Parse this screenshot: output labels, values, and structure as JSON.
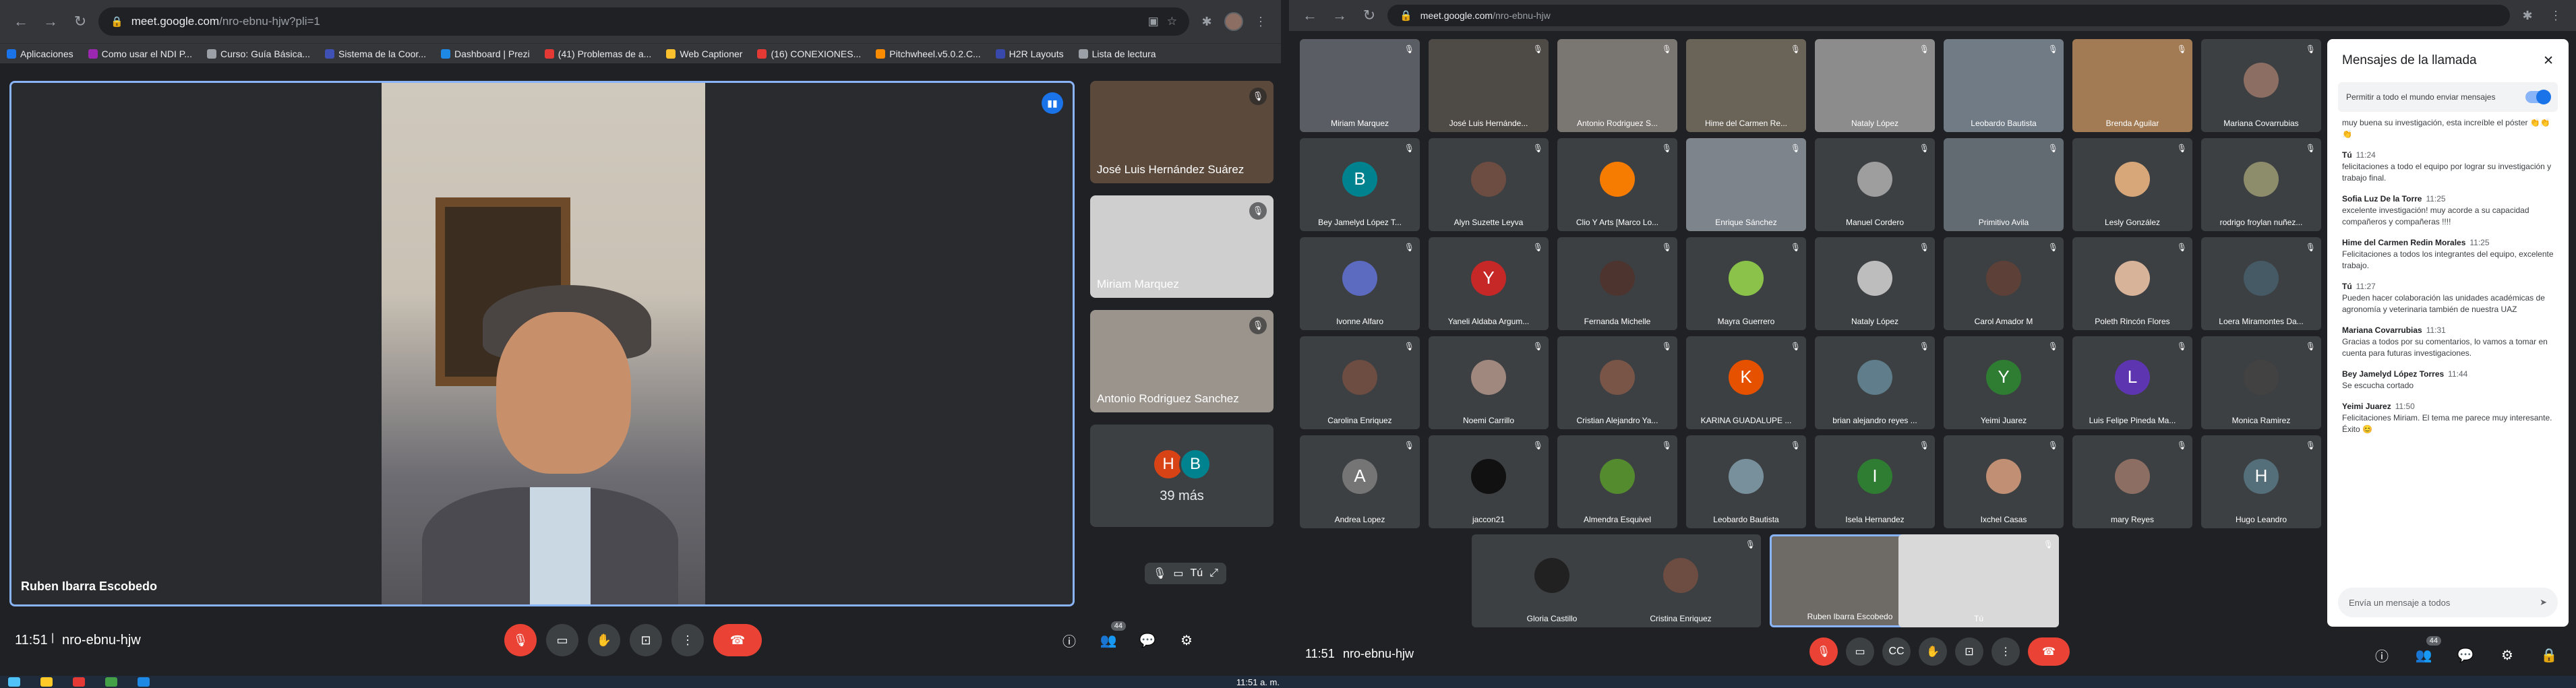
{
  "left": {
    "url_host": "meet.google.com",
    "url_path": "/nro-ebnu-hjw?pli=1",
    "bookmarks": [
      {
        "label": "Aplicaciones",
        "color": "#1a73e8"
      },
      {
        "label": "Como usar el NDI P...",
        "color": "#9c27b0"
      },
      {
        "label": "Curso: Guía Básica...",
        "color": "#9aa0a6"
      },
      {
        "label": "Sistema de la Coor...",
        "color": "#3f51b5"
      },
      {
        "label": "Dashboard | Prezi",
        "color": "#1e88e5"
      },
      {
        "label": "(41) Problemas de a...",
        "color": "#e53935"
      },
      {
        "label": "Web Captioner",
        "color": "#fbc02d"
      },
      {
        "label": "(16) CONEXIONES...",
        "color": "#e53935"
      },
      {
        "label": "Pitchwheel.v5.0.2.C...",
        "color": "#fb8c00"
      },
      {
        "label": "H2R Layouts",
        "color": "#3949ab"
      },
      {
        "label": "Lista de lectura",
        "color": "#9aa0a6"
      }
    ],
    "main_speaker": "Ruben Ibarra Escobedo",
    "side_tiles": [
      {
        "name": "José Luis Hernández Suárez"
      },
      {
        "name": "Miriam Marquez"
      },
      {
        "name": "Antonio Rodriguez Sanchez"
      }
    ],
    "more": {
      "initials": [
        "H",
        "B"
      ],
      "label": "39 más"
    },
    "self_label": "Tú",
    "clock": "11:51",
    "code": "nro-ebnu-hjw",
    "people_count": "44"
  },
  "right": {
    "url_host": "meet.google.com",
    "url_path": "/nro-ebnu-hjw",
    "tiles": [
      {
        "name": "Miriam Marquez",
        "kind": "video",
        "bg": "#5a5d63"
      },
      {
        "name": "José Luis Hernánde...",
        "kind": "video",
        "bg": "#4e4a46"
      },
      {
        "name": "Antonio Rodriguez S...",
        "kind": "video",
        "bg": "#7a7672"
      },
      {
        "name": "Hime del Carmen Re...",
        "kind": "video",
        "bg": "#6a6358"
      },
      {
        "name": "Nataly López",
        "kind": "video",
        "bg": "#8c8c8c"
      },
      {
        "name": "Leobardo Bautista",
        "kind": "video",
        "bg": "#707b86"
      },
      {
        "name": "Brenda Aguilar",
        "kind": "video",
        "bg": "#a27b55"
      },
      {
        "name": "Mariana Covarrubias",
        "kind": "pic",
        "bg": "#3c4043",
        "pc": "#8d6e63"
      },
      {
        "name": "Bey Jamelyd López T...",
        "kind": "ini",
        "bg": "#3c4043",
        "ini": "B",
        "pc": "#00838f"
      },
      {
        "name": "Alyn Suzette Leyva",
        "kind": "pic",
        "bg": "#3c4043",
        "pc": "#6d4c41"
      },
      {
        "name": "Clio Y Arts [Marco Lo...",
        "kind": "pic",
        "bg": "#3c4043",
        "pc": "#f57c00"
      },
      {
        "name": "Enrique Sánchez",
        "kind": "video",
        "bg": "#7d848c"
      },
      {
        "name": "Manuel Cordero",
        "kind": "pic",
        "bg": "#3c4043",
        "pc": "#9e9e9e"
      },
      {
        "name": "Primitivo Avila",
        "kind": "video",
        "bg": "#626a72"
      },
      {
        "name": "Lesly González",
        "kind": "pic",
        "bg": "#3c4043",
        "pc": "#d7a77a"
      },
      {
        "name": "rodrigo froylan nuñez...",
        "kind": "pic",
        "bg": "#3c4043",
        "pc": "#8d8d6b"
      },
      {
        "name": "Ivonne Alfaro",
        "kind": "pic",
        "bg": "#3c4043",
        "pc": "#5c6bc0"
      },
      {
        "name": "Yaneli Aldaba Argum...",
        "kind": "ini",
        "bg": "#3c4043",
        "ini": "Y",
        "pc": "#c62828"
      },
      {
        "name": "Fernanda Michelle",
        "kind": "pic",
        "bg": "#3c4043",
        "pc": "#4e342e"
      },
      {
        "name": "Mayra Guerrero",
        "kind": "pic",
        "bg": "#3c4043",
        "pc": "#8bc34a"
      },
      {
        "name": "Nataly López",
        "kind": "pic",
        "bg": "#3c4043",
        "pc": "#bdbdbd"
      },
      {
        "name": "Carol Amador M",
        "kind": "pic",
        "bg": "#3c4043",
        "pc": "#5d4037"
      },
      {
        "name": "Poleth Rincón Flores",
        "kind": "pic",
        "bg": "#3c4043",
        "pc": "#d7b39a"
      },
      {
        "name": "Loera Miramontes Da...",
        "kind": "pic",
        "bg": "#3c4043",
        "pc": "#455a64"
      },
      {
        "name": "Carolina Enriquez",
        "kind": "pic",
        "bg": "#3c4043",
        "pc": "#6d4c41"
      },
      {
        "name": "Noemi Carrillo",
        "kind": "pic",
        "bg": "#3c4043",
        "pc": "#a1887f"
      },
      {
        "name": "Cristian Alejandro Ya...",
        "kind": "pic",
        "bg": "#3c4043",
        "pc": "#795548"
      },
      {
        "name": "KARINA GUADALUPE ...",
        "kind": "ini",
        "bg": "#3c4043",
        "ini": "K",
        "pc": "#e65100"
      },
      {
        "name": "brian alejandro reyes ...",
        "kind": "pic",
        "bg": "#3c4043",
        "pc": "#607d8b"
      },
      {
        "name": "Yeimi Juarez",
        "kind": "ini",
        "bg": "#3c4043",
        "ini": "Y",
        "pc": "#2e7d32"
      },
      {
        "name": "Luis Felipe Pineda Ma...",
        "kind": "ini",
        "bg": "#3c4043",
        "ini": "L",
        "pc": "#5e35b1"
      },
      {
        "name": "Monica Ramirez",
        "kind": "pic",
        "bg": "#3c4043",
        "pc": "#424242"
      },
      {
        "name": "Andrea Lopez",
        "kind": "ini",
        "bg": "#3c4043",
        "ini": "A",
        "pc": "#757575"
      },
      {
        "name": "jaccon21",
        "kind": "pic",
        "bg": "#3c4043",
        "pc": "#111111"
      },
      {
        "name": "Almendra Esquivel",
        "kind": "pic",
        "bg": "#3c4043",
        "pc": "#558b2f"
      },
      {
        "name": "Leobardo Bautista",
        "kind": "pic",
        "bg": "#3c4043",
        "pc": "#78909c"
      },
      {
        "name": "Isela Hernandez",
        "kind": "ini",
        "bg": "#3c4043",
        "ini": "I",
        "pc": "#2e7d32"
      },
      {
        "name": "Ixchel Casas",
        "kind": "pic",
        "bg": "#3c4043",
        "pc": "#c08f74"
      },
      {
        "name": "mary Reyes",
        "kind": "pic",
        "bg": "#3c4043",
        "pc": "#8d6e63"
      },
      {
        "name": "Hugo Leandro",
        "kind": "ini",
        "bg": "#3c4043",
        "ini": "H",
        "pc": "#546e7a"
      },
      {
        "name": "Gloria Castillo",
        "kind": "pic",
        "bg": "#3c4043",
        "pc": "#212121"
      },
      {
        "name": "Cristina Enriquez",
        "kind": "pic",
        "bg": "#3c4043",
        "pc": "#6d4c41"
      },
      {
        "name": "Ruben Ibarra Escobedo",
        "kind": "video",
        "bg": "#6e6a66",
        "active": true
      },
      {
        "name": "Tú",
        "kind": "video",
        "bg": "#d9d9d9"
      }
    ],
    "chat": {
      "title": "Mensajes de la llamada",
      "toggle_label": "Permitir a todo el mundo enviar mensajes",
      "messages": [
        {
          "who": "",
          "time": "",
          "text": "muy buena su investigación, esta increíble el póster 👏👏👏"
        },
        {
          "who": "Tú",
          "time": "11:24",
          "text": "felicitaciones a todo el equipo por lograr su investigación y trabajo final."
        },
        {
          "who": "Sofia Luz De la Torre",
          "time": "11:25",
          "text": "excelente investigación! muy acorde a su capacidad compañeros y compañeras !!!!"
        },
        {
          "who": "Hime del Carmen Redin Morales",
          "time": "11:25",
          "text": "Felicitaciones a todos los integrantes del equipo, excelente trabajo."
        },
        {
          "who": "Tú",
          "time": "11:27",
          "text": "Pueden hacer colaboración las unidades académicas de agronomía y veterinaria también de nuestra UAZ"
        },
        {
          "who": "Mariana Covarrubias",
          "time": "11:31",
          "text": "Gracias a todos por su comentarios, lo vamos a tomar en cuenta para futuras investigaciones."
        },
        {
          "who": "Bey Jamelyd López Torres",
          "time": "11:44",
          "text": "Se escucha cortado"
        },
        {
          "who": "Yeimi Juarez",
          "time": "11:50",
          "text": "Felicitaciones Miriam. El tema me parece muy interesante. Éxito 😊"
        }
      ],
      "placeholder": "Envía un mensaje a todos"
    },
    "clock": "11:51",
    "code": "nro-ebnu-hjw",
    "people_count": "44"
  },
  "taskbar_time": "11:51 a. m."
}
